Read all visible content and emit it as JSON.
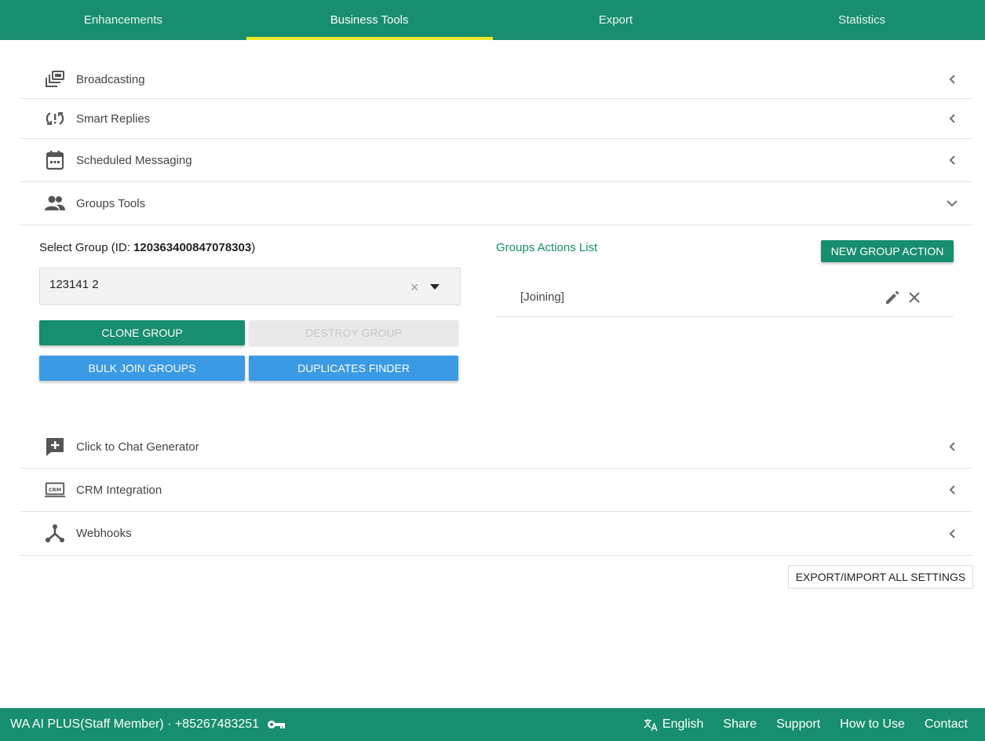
{
  "tabs": [
    {
      "label": "Enhancements",
      "active": false
    },
    {
      "label": "Business Tools",
      "active": true
    },
    {
      "label": "Export",
      "active": false
    },
    {
      "label": "Statistics",
      "active": false
    }
  ],
  "sections": {
    "broadcasting": "Broadcasting",
    "smart_replies": "Smart Replies",
    "scheduled_messaging": "Scheduled Messaging",
    "groups_tools": "Groups Tools",
    "click_to_chat": "Click to Chat Generator",
    "crm_integration": "CRM Integration",
    "webhooks": "Webhooks"
  },
  "groups": {
    "select_label_prefix": "Select Group (ID: ",
    "group_id": "120363400847078303",
    "select_label_suffix": ")",
    "selected_group": "123141 2",
    "clone_button": "CLONE GROUP",
    "destroy_button": "DESTROY GROUP",
    "bulk_join_button": "BULK JOIN GROUPS",
    "duplicates_button": "DUPLICATES FINDER",
    "actions_title": "Groups Actions List",
    "new_action_button": "NEW GROUP ACTION",
    "actions": [
      "[Joining]"
    ]
  },
  "export_import_button": "EXPORT/IMPORT ALL SETTINGS",
  "footer": {
    "account": "WA AI PLUS(Staff Member) · +85267483251",
    "language": "English",
    "share": "Share",
    "support": "Support",
    "how_to_use": "How to Use",
    "contact": "Contact"
  },
  "colors": {
    "brand_green": "#178e6e",
    "tab_underline": "#f1e72a",
    "button_blue": "#3a9ae4",
    "icon_gray": "#555555"
  },
  "icons": [
    "broadcast-icon",
    "smart-replies-icon",
    "calendar-icon",
    "group-icon",
    "add-comment-icon",
    "crm-icon",
    "webhook-icon",
    "chevron-left-icon",
    "chevron-down-icon",
    "clear-icon",
    "dropdown-arrow-icon",
    "edit-icon",
    "close-icon",
    "key-icon",
    "translate-icon"
  ]
}
